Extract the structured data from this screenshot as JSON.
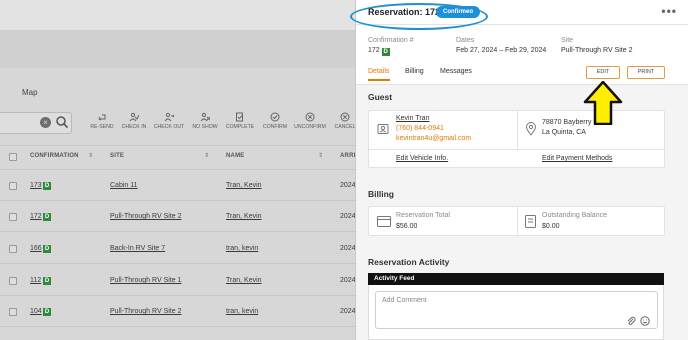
{
  "background": {
    "map_label": "Map",
    "toolbar": [
      {
        "label": "RE-SEND",
        "icon": "resend-icon"
      },
      {
        "label": "CHECK IN",
        "icon": "check-in-icon"
      },
      {
        "label": "CHECK OUT",
        "icon": "check-out-icon"
      },
      {
        "label": "NO SHOW",
        "icon": "no-show-icon"
      },
      {
        "label": "COMPLETE",
        "icon": "complete-icon"
      },
      {
        "label": "CONFIRM",
        "icon": "confirm-icon"
      },
      {
        "label": "UNCONFIRM",
        "icon": "unconfirm-icon"
      },
      {
        "label": "CANCEL",
        "icon": "cancel-icon"
      }
    ],
    "columns": {
      "confirmation": "CONFIRMATION",
      "site": "SITE",
      "name": "NAME",
      "arrival": "ARRI"
    },
    "rows": [
      {
        "confirmation": "173",
        "badge": "D",
        "site": "Cabin 11",
        "name": "Tran, Kevin",
        "arrival": "2024"
      },
      {
        "confirmation": "172",
        "badge": "D",
        "site": "Pull-Through RV Site 2",
        "name": "Tran, Kevin",
        "arrival": "2024"
      },
      {
        "confirmation": "166",
        "badge": "D",
        "site": "Back-In RV Site 7",
        "name": "tran, kevin",
        "arrival": "2024"
      },
      {
        "confirmation": "112",
        "badge": "D",
        "site": "Pull-Through RV Site 1",
        "name": "Tran, Kevin",
        "arrival": "2024"
      },
      {
        "confirmation": "104",
        "badge": "D",
        "site": "Pull-Through RV Site 2",
        "name": "tran, kevin",
        "arrival": "2024"
      }
    ]
  },
  "panel": {
    "title": "Reservation: 172",
    "status": "Confirmed",
    "summary": {
      "confirmation_label": "Confirmation #",
      "confirmation_value": "172",
      "confirmation_badge": "D",
      "dates_label": "Dates",
      "dates_value": "Feb 27, 2024 – Feb 29, 2024",
      "site_label": "Site",
      "site_value": "Pull-Through RV Site 2"
    },
    "tabs": [
      "Details",
      "Billing",
      "Messages"
    ],
    "edit_label": "EDIT",
    "print_label": "PRINT",
    "guest": {
      "title": "Guest",
      "name": "Kevin Tran",
      "phone": "(760) 844-0941",
      "email": "kevintran4u@gmail.com",
      "address_line1": "78870 Bayberry Lane",
      "address_line2": "La Quinta, CA",
      "edit_vehicle": "Edit Vehicle Info.",
      "edit_payment": "Edit Payment Methods"
    },
    "billing": {
      "title": "Billing",
      "total_label": "Reservation Total",
      "total_value": "$56.00",
      "balance_label": "Outstanding Balance",
      "balance_value": "$0.00"
    },
    "activity": {
      "title": "Reservation Activity",
      "feed_label": "Activity Feed",
      "comment_placeholder": "Add Comment"
    }
  },
  "colors": {
    "accent": "#e07a00",
    "confirmed": "#1e90d8",
    "badge": "#2e8b3a",
    "annotation_arrow": "#ffee00"
  }
}
